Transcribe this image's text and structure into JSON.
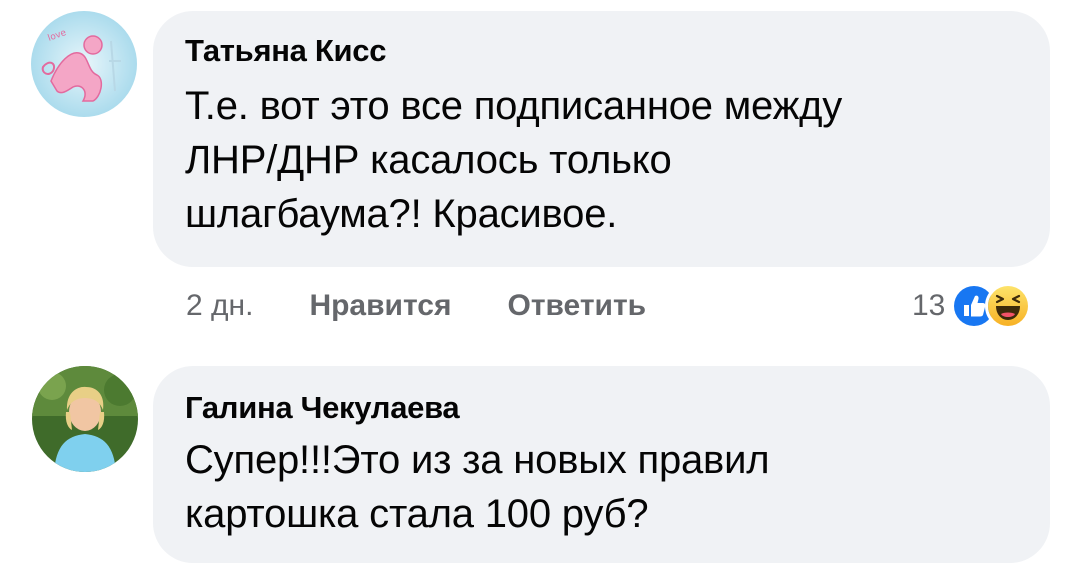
{
  "comments": [
    {
      "author": "Татьяна Кисс",
      "text_lines": [
        "Т.е. вот это все подписанное между",
        "ЛНР/ДНР касалось только",
        "шлагбаума?! Красивое."
      ],
      "time": "2 дн.",
      "like_label": "Нравится",
      "reply_label": "Ответить",
      "reaction_count": "13",
      "reactions": [
        "like-icon",
        "haha-icon"
      ]
    },
    {
      "author": "Галина Чекулаева",
      "text_lines": [
        "Супер!!!Это из за новых правил",
        "картошка стала 100 руб?"
      ]
    }
  ],
  "colors": {
    "bubble": "#f0f2f5",
    "meta_text": "#65676b",
    "like_blue": "#1877f2",
    "haha_yellow": "#f7b125"
  }
}
